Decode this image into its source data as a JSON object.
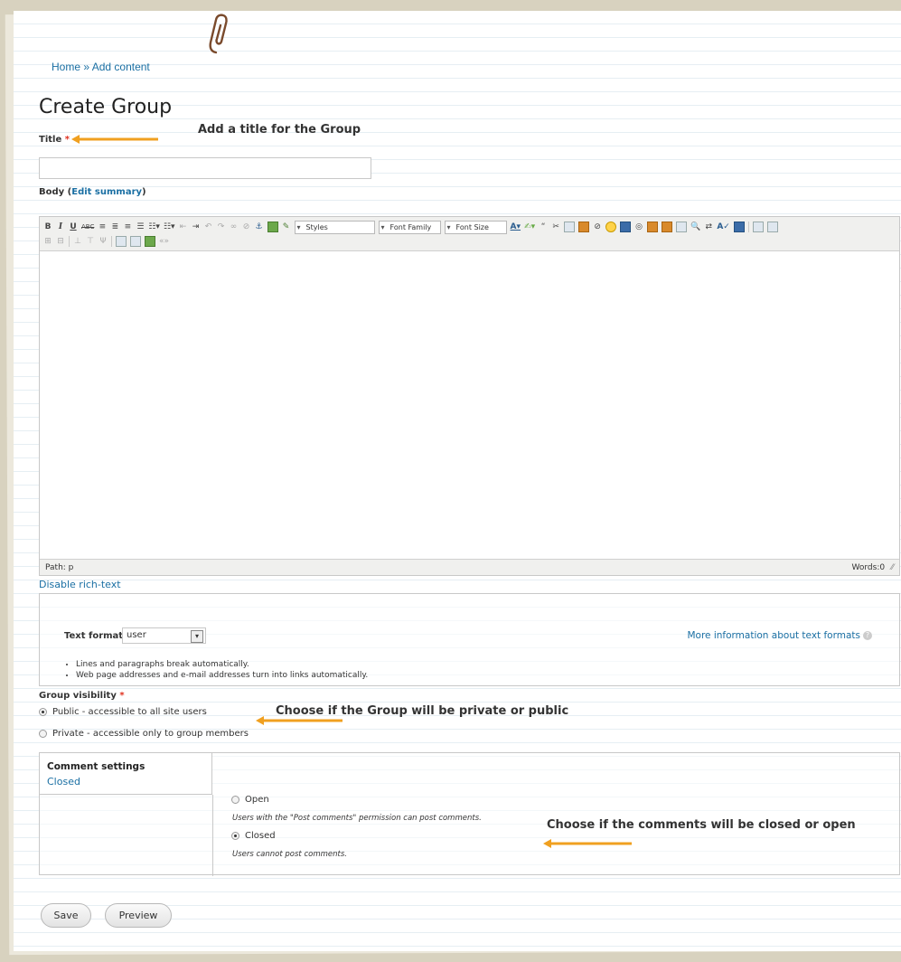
{
  "breadcrumb": {
    "home": "Home",
    "sep": "»",
    "current": "Add content"
  },
  "page_title": "Create Group",
  "annotations": {
    "title_hint": "Add a title for the Group",
    "visibility_hint": "Choose if the Group will be private or public",
    "comments_hint": "Choose if the comments will be closed or open"
  },
  "title_field": {
    "label": "Title",
    "required_mark": "*",
    "value": ""
  },
  "body_field": {
    "label": "Body",
    "edit_summary": "Edit summary"
  },
  "editor": {
    "styles_select": "Styles",
    "font_family_select": "Font Family",
    "font_size_select": "Font Size",
    "path_label": "Path: p",
    "words_label": "Words:0",
    "disable_rich_text": "Disable rich-text"
  },
  "text_format": {
    "label": "Text format",
    "selected": "user",
    "more_info": "More information about text formats",
    "tips": [
      "Lines and paragraphs break automatically.",
      "Web page addresses and e-mail addresses turn into links automatically."
    ]
  },
  "group_visibility": {
    "label": "Group visibility",
    "required_mark": "*",
    "options": [
      {
        "label": "Public - accessible to all site users",
        "selected": true
      },
      {
        "label": "Private - accessible only to group members",
        "selected": false
      }
    ]
  },
  "comment_settings": {
    "title": "Comment settings",
    "summary": "Closed",
    "open_label": "Open",
    "open_desc": "Users with the \"Post comments\" permission can post comments.",
    "closed_label": "Closed",
    "closed_desc": "Users cannot post comments.",
    "selected": "Closed"
  },
  "actions": {
    "save": "Save",
    "preview": "Preview"
  },
  "colors": {
    "link": "#1a6fa3",
    "required": "#e0301e",
    "annotation_arrow": "#f0a020",
    "paper_edge": "#d8d2bf"
  }
}
